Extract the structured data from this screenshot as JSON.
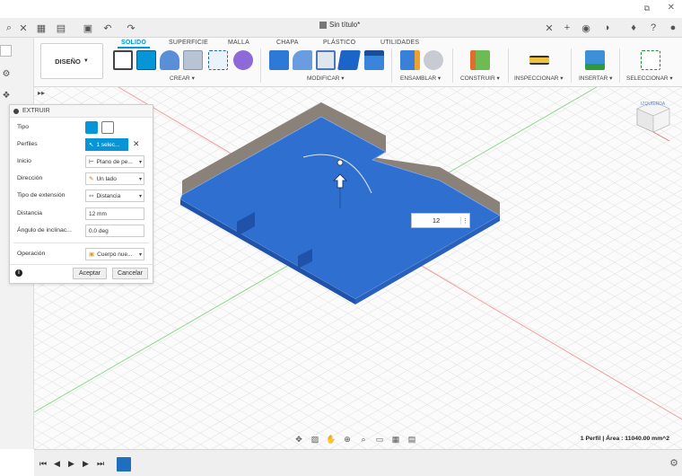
{
  "app": {
    "document_title": "Sin título*"
  },
  "ribbon": {
    "workspace_label": "DISEÑO",
    "tabs": [
      {
        "label": "SOLIDO",
        "active": true
      },
      {
        "label": "SUPERFICIE",
        "active": false
      },
      {
        "label": "MALLA",
        "active": false
      },
      {
        "label": "CHAPA",
        "active": false
      },
      {
        "label": "PLÁSTICO",
        "active": false
      },
      {
        "label": "UTILIDADES",
        "active": false
      }
    ],
    "groups": {
      "create": "CREAR",
      "modify": "MODIFICAR",
      "assemble": "ENSAMBLAR",
      "construct": "CONSTRUIR",
      "inspect": "INSPECCIONAR",
      "insert": "INSERTAR",
      "select": "SELECCIONAR"
    },
    "accent_color": "#0696d7"
  },
  "extrude_dialog": {
    "title": "EXTRUIR",
    "labels": {
      "type": "Tipo",
      "profiles": "Perfiles",
      "start": "Inicio",
      "direction": "Dirección",
      "extent_type": "Tipo de extensión",
      "distance": "Distancia",
      "taper_angle": "Ángulo de inclinac...",
      "operation": "Operación"
    },
    "values": {
      "profiles": "1 selec...",
      "start": "Plano de pe...",
      "direction": "Un lado",
      "extent_type": "Distancia",
      "distance": "12 mm",
      "taper_angle": "0.0 deg",
      "operation": "Cuerpo nue..."
    },
    "buttons": {
      "ok": "Aceptar",
      "cancel": "Cancelar"
    }
  },
  "viewport": {
    "distance_input_value": "12",
    "viewcube_label": "IZQUIERDA",
    "model_color": "#2f6fcf"
  },
  "status_bar": {
    "text": "1 Perfil | Área : 11040.00 mm^2"
  }
}
